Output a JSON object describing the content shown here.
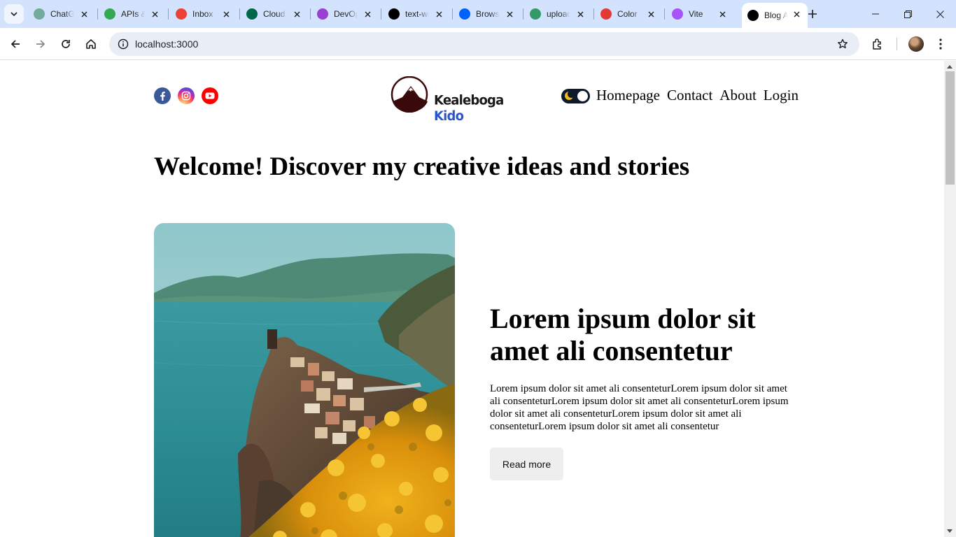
{
  "browser": {
    "tabs": [
      {
        "label": "ChatGPT",
        "icon": "chatgpt-icon",
        "color": "#74aa9c"
      },
      {
        "label": "APIs & Services",
        "icon": "google-maps-icon",
        "color": "#34a853"
      },
      {
        "label": "Inbox",
        "icon": "gmail-icon",
        "color": "#ea4335"
      },
      {
        "label": "Cloud",
        "icon": "mongodb-icon",
        "color": "#00684a"
      },
      {
        "label": "DevOps",
        "icon": "devops-icon",
        "color": "#9b3fd4"
      },
      {
        "label": "text-wrap",
        "icon": "medium-icon",
        "color": "#000000"
      },
      {
        "label": "Browse",
        "icon": "dropbox-icon",
        "color": "#0061fe"
      },
      {
        "label": "upload",
        "icon": "wikimedia-icon",
        "color": "#339966"
      },
      {
        "label": "Color",
        "icon": "color-picker-icon",
        "color": "#e53935"
      },
      {
        "label": "Vite",
        "icon": "vite-icon",
        "color": "#a855f7"
      },
      {
        "label": "Blog App",
        "icon": "nextjs-icon",
        "color": "#000000"
      }
    ],
    "active_tab_index": 10,
    "url": "localhost:3000"
  },
  "site": {
    "social": [
      {
        "name": "facebook",
        "color": "#3b5998"
      },
      {
        "name": "instagram",
        "color": "#d6249f"
      },
      {
        "name": "youtube",
        "color": "#ff0000"
      }
    ],
    "logo": {
      "word1": "Kealeboga",
      "word2": "Kido",
      "color1": "#1a1a1a",
      "color2": "#2a57c8"
    },
    "nav": [
      "Homepage",
      "Contact",
      "About",
      "Login"
    ],
    "welcome_bold": "Welcome!",
    "welcome_rest": " Discover my creative ideas and stories",
    "post": {
      "image": "coastal-village-cliff-photo",
      "title": "Lorem ipsum dolor sit amet ali consentetur",
      "description": "Lorem ipsum dolor sit amet ali consenteturLorem ipsum dolor sit amet ali consenteturLorem ipsum dolor sit amet ali consenteturLorem ipsum dolor sit amet ali consenteturLorem ipsum dolor sit amet ali consenteturLorem ipsum dolor sit amet ali consentetur",
      "read_more": "Read more"
    }
  }
}
